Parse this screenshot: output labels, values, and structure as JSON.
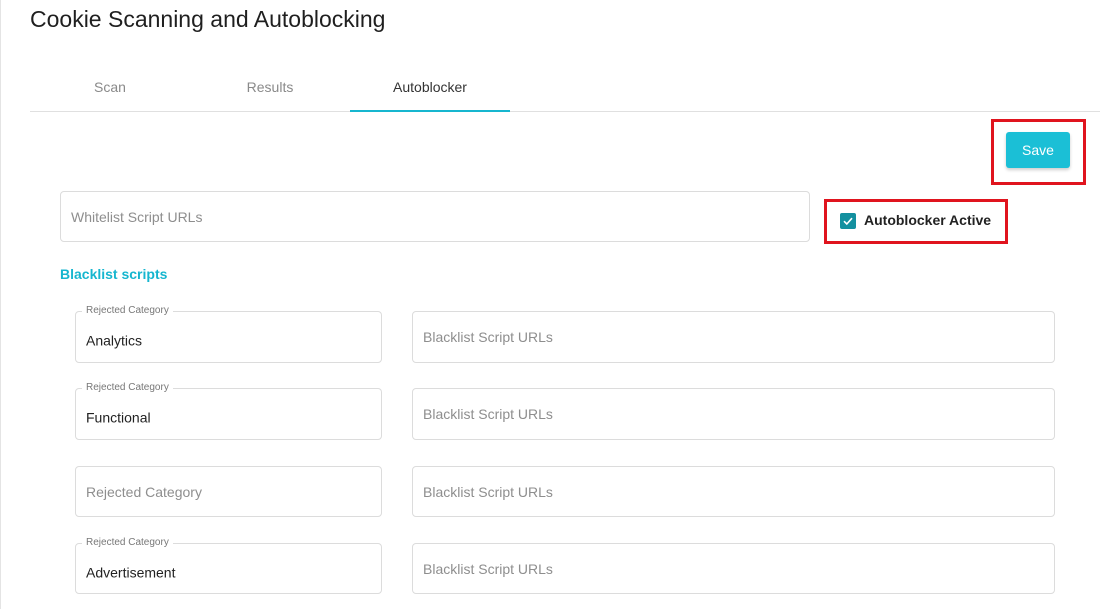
{
  "page": {
    "title": "Cookie Scanning and Autoblocking"
  },
  "tabs": [
    {
      "label": "Scan",
      "active": false
    },
    {
      "label": "Results",
      "active": false
    },
    {
      "label": "Autoblocker",
      "active": true
    }
  ],
  "toolbar": {
    "save_label": "Save"
  },
  "whitelist": {
    "placeholder": "Whitelist Script URLs",
    "value": ""
  },
  "autoblocker": {
    "label": "Autoblocker Active",
    "checked": true
  },
  "blacklist": {
    "heading": "Blacklist scripts",
    "rows": [
      {
        "category_label": "Rejected Category",
        "category_value": "Analytics",
        "urls_placeholder": "Blacklist Script URLs"
      },
      {
        "category_label": "Rejected Category",
        "category_value": "Functional",
        "urls_placeholder": "Blacklist Script URLs"
      },
      {
        "category_label": "Rejected Category",
        "category_value": "",
        "urls_placeholder": "Blacklist Script URLs"
      },
      {
        "category_label": "Rejected Category",
        "category_value": "Advertisement",
        "urls_placeholder": "Blacklist Script URLs"
      }
    ]
  },
  "colors": {
    "accent": "#16b6cf",
    "button": "#1bbfd6",
    "checkbox": "#13909f",
    "highlight": "#e0141e"
  }
}
